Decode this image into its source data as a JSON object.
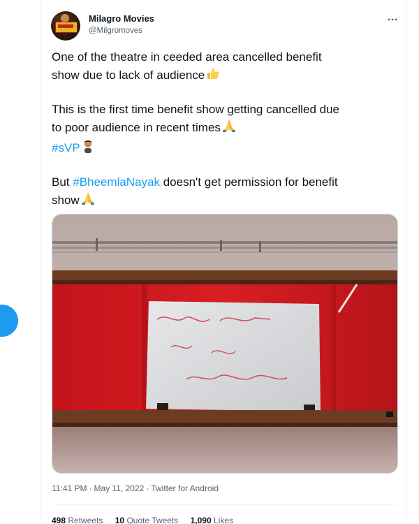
{
  "author": {
    "name": "Milagro Movies",
    "handle": "@Milgromoves"
  },
  "more_icon": "more-horizontal-icon",
  "tweet": {
    "para1_line1": "One of the theatre in ceeded area cancelled benefit",
    "para1_line2": "show due to lack of audience",
    "para2_line1": "This is the first time benefit show getting cancelled due",
    "para2_line2": "to poor audience in recent times",
    "para2_hashtag": "#sVP",
    "para3_line1_prefix": "But ",
    "para3_hashtag": "#BheemlaNayak",
    "para3_line1_suffix": " doesn't get permission for benefit",
    "para3_line2": "show",
    "emoji_thumbs": "thumbs-up-icon",
    "emoji_pray": "folded-hands-icon",
    "emoji_person": "person-icon"
  },
  "media": {
    "description_icon": "photo-icon"
  },
  "meta": {
    "time": "11:41 PM",
    "date": "May 11, 2022",
    "source": "Twitter for Android",
    "separator": "·"
  },
  "stats": {
    "retweets_count": "498",
    "retweets_label": "Retweets",
    "quotes_count": "10",
    "quotes_label": "Quote Tweets",
    "likes_count": "1,090",
    "likes_label": "Likes"
  },
  "colors": {
    "accent": "#1d9bf0",
    "text": "#0f1419",
    "muted": "#536471"
  }
}
